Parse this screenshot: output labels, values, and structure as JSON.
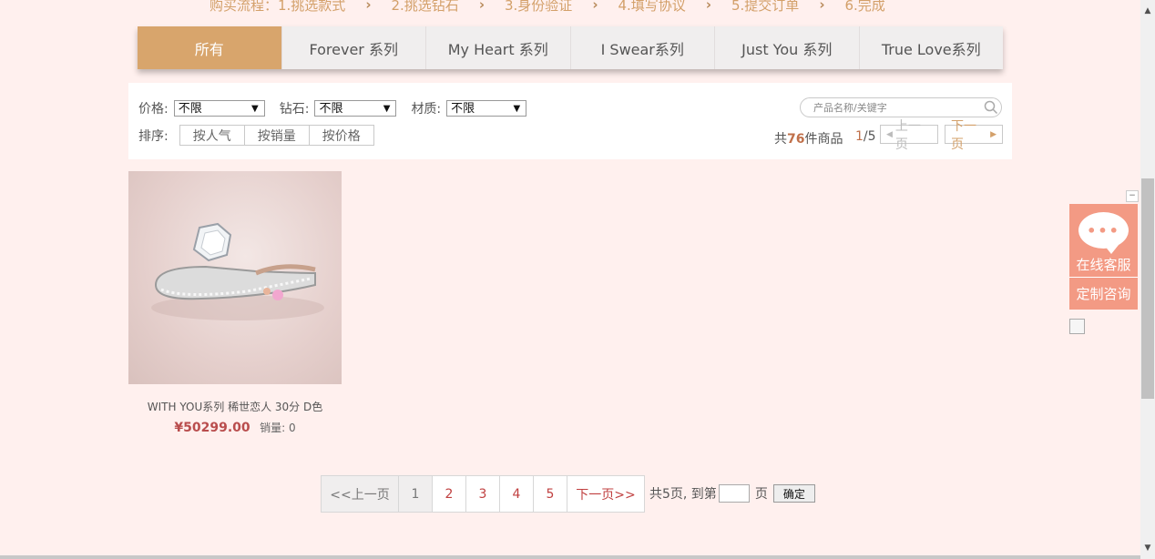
{
  "steps": [
    {
      "label": "购买流程：1.挑选款式"
    },
    {
      "label": "2.挑选钻石"
    },
    {
      "label": "3.身份验证"
    },
    {
      "label": "4.填写协议"
    },
    {
      "label": "5.提交订单"
    },
    {
      "label": "6.完成"
    }
  ],
  "tabs": [
    {
      "label": "所有",
      "active": true
    },
    {
      "label": "Forever 系列"
    },
    {
      "label": "My Heart 系列"
    },
    {
      "label": "I Swear系列"
    },
    {
      "label": "Just You 系列"
    },
    {
      "label": "True Love系列"
    }
  ],
  "filter": {
    "price_label": "价格:",
    "price_value": "不限",
    "diamond_label": "钻石:",
    "diamond_value": "不限",
    "material_label": "材质:",
    "material_value": "不限",
    "sort_label": "排序:",
    "sort_options": [
      "按人气",
      "按销量",
      "按价格"
    ],
    "search_placeholder": "产品名称/关键字",
    "count_prefix": "共",
    "count_value": "76",
    "count_suffix": "件商品",
    "page_current": "1",
    "page_total": "/5",
    "prev_label": "上一页",
    "next_label": "下一页"
  },
  "product": {
    "name": "WITH YOU系列 稀世恋人 30分 D色",
    "price": "¥50299.00",
    "sales": "销量: 0"
  },
  "pagination": {
    "prev": "<<上一页",
    "pages": [
      "1",
      "2",
      "3",
      "4",
      "5"
    ],
    "next": "下一页>>",
    "total": "共5页, 到第",
    "page_unit": "页",
    "confirm": "确定"
  },
  "service": {
    "online": "在线客服",
    "custom": "定制咨询",
    "dots": "•••",
    "minimize": "−"
  },
  "colors": {
    "accent": "#d8a56c",
    "price": "#b94d4d",
    "service": "#f39a84",
    "background": "#fff0ee"
  }
}
